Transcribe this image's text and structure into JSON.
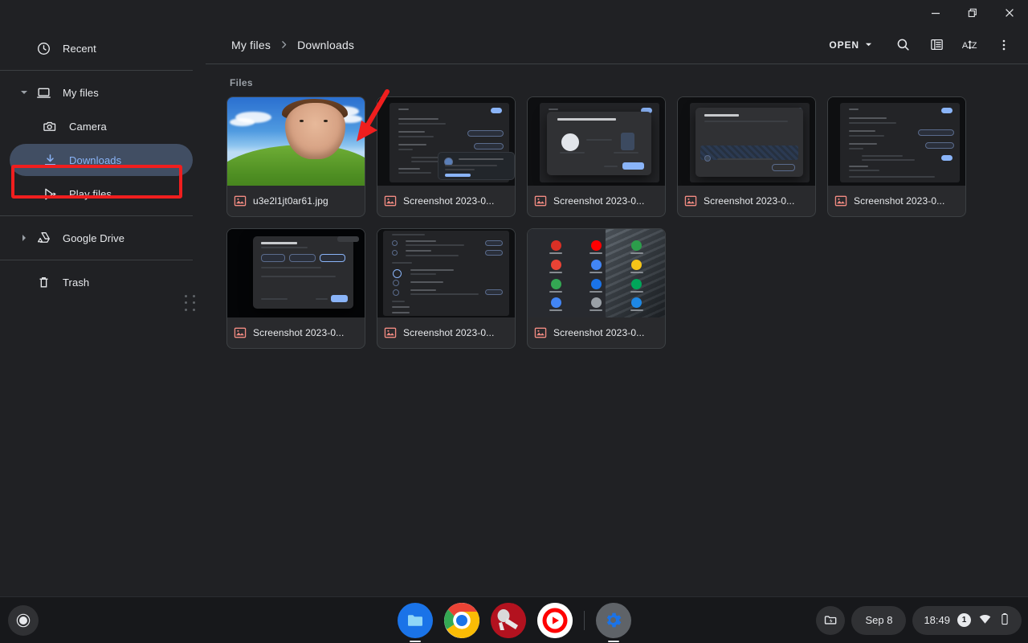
{
  "window": {
    "controls": [
      {
        "name": "minimize",
        "glyph": "minimize-icon"
      },
      {
        "name": "restore",
        "glyph": "restore-icon"
      },
      {
        "name": "close",
        "glyph": "close-icon"
      }
    ]
  },
  "sidebar": {
    "items": [
      {
        "id": "recent",
        "label": "Recent",
        "icon": "clock-icon",
        "level": 0,
        "twisty": "none",
        "selected": false
      },
      {
        "id": "my-files",
        "label": "My files",
        "icon": "laptop-icon",
        "level": 0,
        "twisty": "expanded",
        "selected": false
      },
      {
        "id": "camera",
        "label": "Camera",
        "icon": "camera-icon",
        "level": 1,
        "twisty": "none",
        "selected": false
      },
      {
        "id": "downloads",
        "label": "Downloads",
        "icon": "download-icon",
        "level": 1,
        "twisty": "none",
        "selected": true
      },
      {
        "id": "play-files",
        "label": "Play files",
        "icon": "play-store-icon",
        "level": 1,
        "twisty": "none",
        "selected": false
      },
      {
        "id": "google-drive",
        "label": "Google Drive",
        "icon": "google-drive-icon",
        "level": 0,
        "twisty": "collapsed",
        "selected": false
      },
      {
        "id": "trash",
        "label": "Trash",
        "icon": "trash-icon",
        "level": 0,
        "twisty": "none",
        "selected": false
      }
    ],
    "resize_handle": "sidebar-resize-handle"
  },
  "toolbar": {
    "breadcrumb": {
      "root": "My files",
      "separator": "›",
      "current": "Downloads"
    },
    "open_label": "OPEN",
    "actions": [
      {
        "id": "search",
        "name": "search-icon",
        "tooltip": "Search"
      },
      {
        "id": "view",
        "name": "list-view-icon",
        "tooltip": "Switch to list view"
      },
      {
        "id": "sort",
        "name": "sort-az-icon",
        "tooltip": "Sort"
      },
      {
        "id": "more",
        "name": "more-vert-icon",
        "tooltip": "More…"
      }
    ]
  },
  "content": {
    "section_label": "Files",
    "files": [
      {
        "name": "u3e2l1jt0ar61.jpg",
        "thumb": "bliss-face",
        "type": "image"
      },
      {
        "name": "Screenshot 2023-0...",
        "thumb": "settings-toast",
        "type": "image"
      },
      {
        "name": "Screenshot 2023-0...",
        "thumb": "pairing-dialog",
        "type": "image"
      },
      {
        "name": "Screenshot 2023-0...",
        "thumb": "nearby-dialog",
        "type": "image"
      },
      {
        "name": "Screenshot 2023-0...",
        "thumb": "settings-plain",
        "type": "image"
      },
      {
        "name": "Screenshot 2023-0...",
        "thumb": "visibility-dialog",
        "type": "image"
      },
      {
        "name": "Screenshot 2023-0...",
        "thumb": "settings-list",
        "type": "image"
      },
      {
        "name": "Screenshot 2023-0...",
        "thumb": "app-launcher",
        "type": "image"
      }
    ]
  },
  "annotations": {
    "highlight_box": "downloads-highlight",
    "arrow": "pointer-arrow-to-first-file",
    "color": "#f01e1e"
  },
  "shelf": {
    "launcher": "launcher-button",
    "apps": [
      {
        "id": "files",
        "name": "files-app-icon",
        "running": true
      },
      {
        "id": "chrome",
        "name": "chrome-icon",
        "running": false
      },
      {
        "id": "red-app",
        "name": "pinned-app-icon",
        "running": false
      },
      {
        "id": "youtube-music",
        "name": "youtube-music-icon",
        "running": false
      },
      {
        "id": "settings",
        "name": "settings-gear-icon",
        "running": true
      }
    ],
    "tray": {
      "capture_icon": "screen-capture-icon",
      "date": "Sep 8",
      "time": "18:49",
      "notification_count": "1",
      "wifi_icon": "wifi-icon",
      "battery_icon": "battery-icon"
    }
  },
  "colors": {
    "accent": "#8ab4f8",
    "bg": "#202124",
    "surface": "#292a2d",
    "selected_pill": "#414e63",
    "annotation_red": "#f01e1e",
    "file_icon": "#f28b82"
  }
}
